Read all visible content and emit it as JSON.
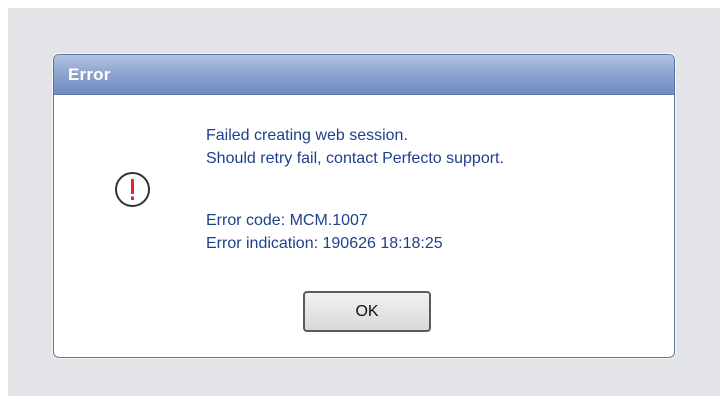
{
  "dialog": {
    "title": "Error",
    "icon": "error-icon",
    "accent_color": "#6f8bc1",
    "message_color": "#1f3f8c",
    "icon_color": "#e02a2a",
    "message_line_1": "Failed creating web session.",
    "message_line_2": "Should retry fail, contact Perfecto support.",
    "error_code": "Error code: MCM.1007",
    "error_indication": "Error indication: 190626 18:18:25",
    "ok_label": "OK"
  }
}
